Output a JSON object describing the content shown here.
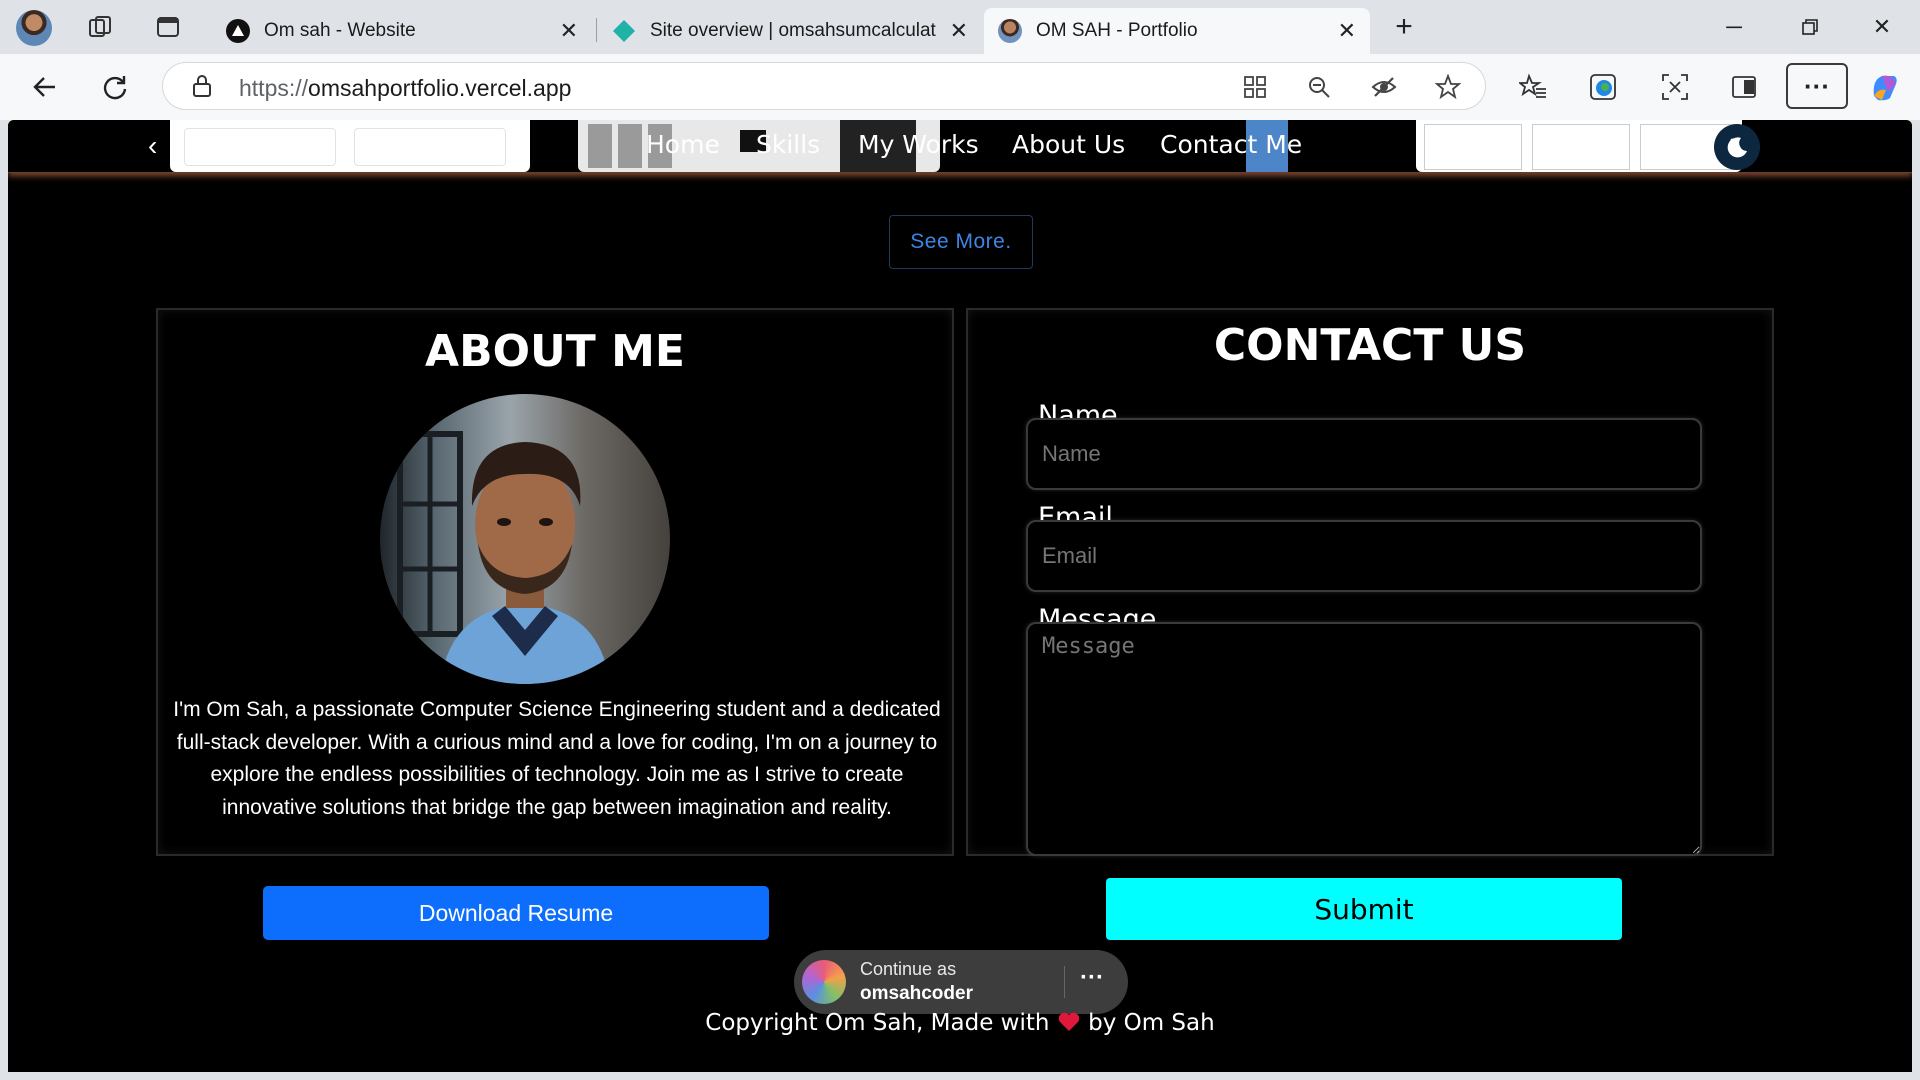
{
  "browser": {
    "tabs": [
      {
        "title": "Om sah - Website",
        "active": false
      },
      {
        "title": "Site overview | omsahsumcalculat",
        "active": false
      },
      {
        "title": "OM SAH - Portfolio",
        "active": true
      }
    ],
    "url_scheme": "https://",
    "url_host": "omsahportfolio.vercel.app",
    "icons": [
      "back-icon",
      "refresh-icon",
      "lock-icon",
      "apps-icon",
      "zoom-out-icon",
      "tracking-icon",
      "favorite-star-icon",
      "favorites-icon",
      "edge-icon",
      "screenshot-icon",
      "collections-icon",
      "more-icon",
      "copilot-icon"
    ]
  },
  "nav": {
    "links": [
      "Home",
      "Skills",
      "My Works",
      "About Us",
      "Contact Me"
    ]
  },
  "see_more": "See More.",
  "about": {
    "title": "ABOUT ME",
    "text": "I'm Om Sah, a passionate Computer Science Engineering student and a dedicated full-stack developer. With a curious mind and a love for coding, I'm on a journey to explore the endless possibilities of technology. Join me as I strive to create innovative solutions that bridge the gap between imagination and reality.",
    "button": "Download Resume"
  },
  "contact": {
    "title": "CONTACT US",
    "name_label": "Name",
    "name_placeholder": "Name",
    "email_label": "Email",
    "email_placeholder": "Email",
    "message_label": "Message",
    "message_placeholder": "Message",
    "submit": "Submit"
  },
  "continue_prompt": {
    "line1": "Continue as",
    "line2": "omsahcoder",
    "more": "···"
  },
  "footer": {
    "before": "Copyright Om Sah, Made with",
    "after": "by Om Sah"
  },
  "colors": {
    "accent_blue": "#0d6efd",
    "submit_cyan": "#00ffff",
    "page_bg": "#000000"
  }
}
